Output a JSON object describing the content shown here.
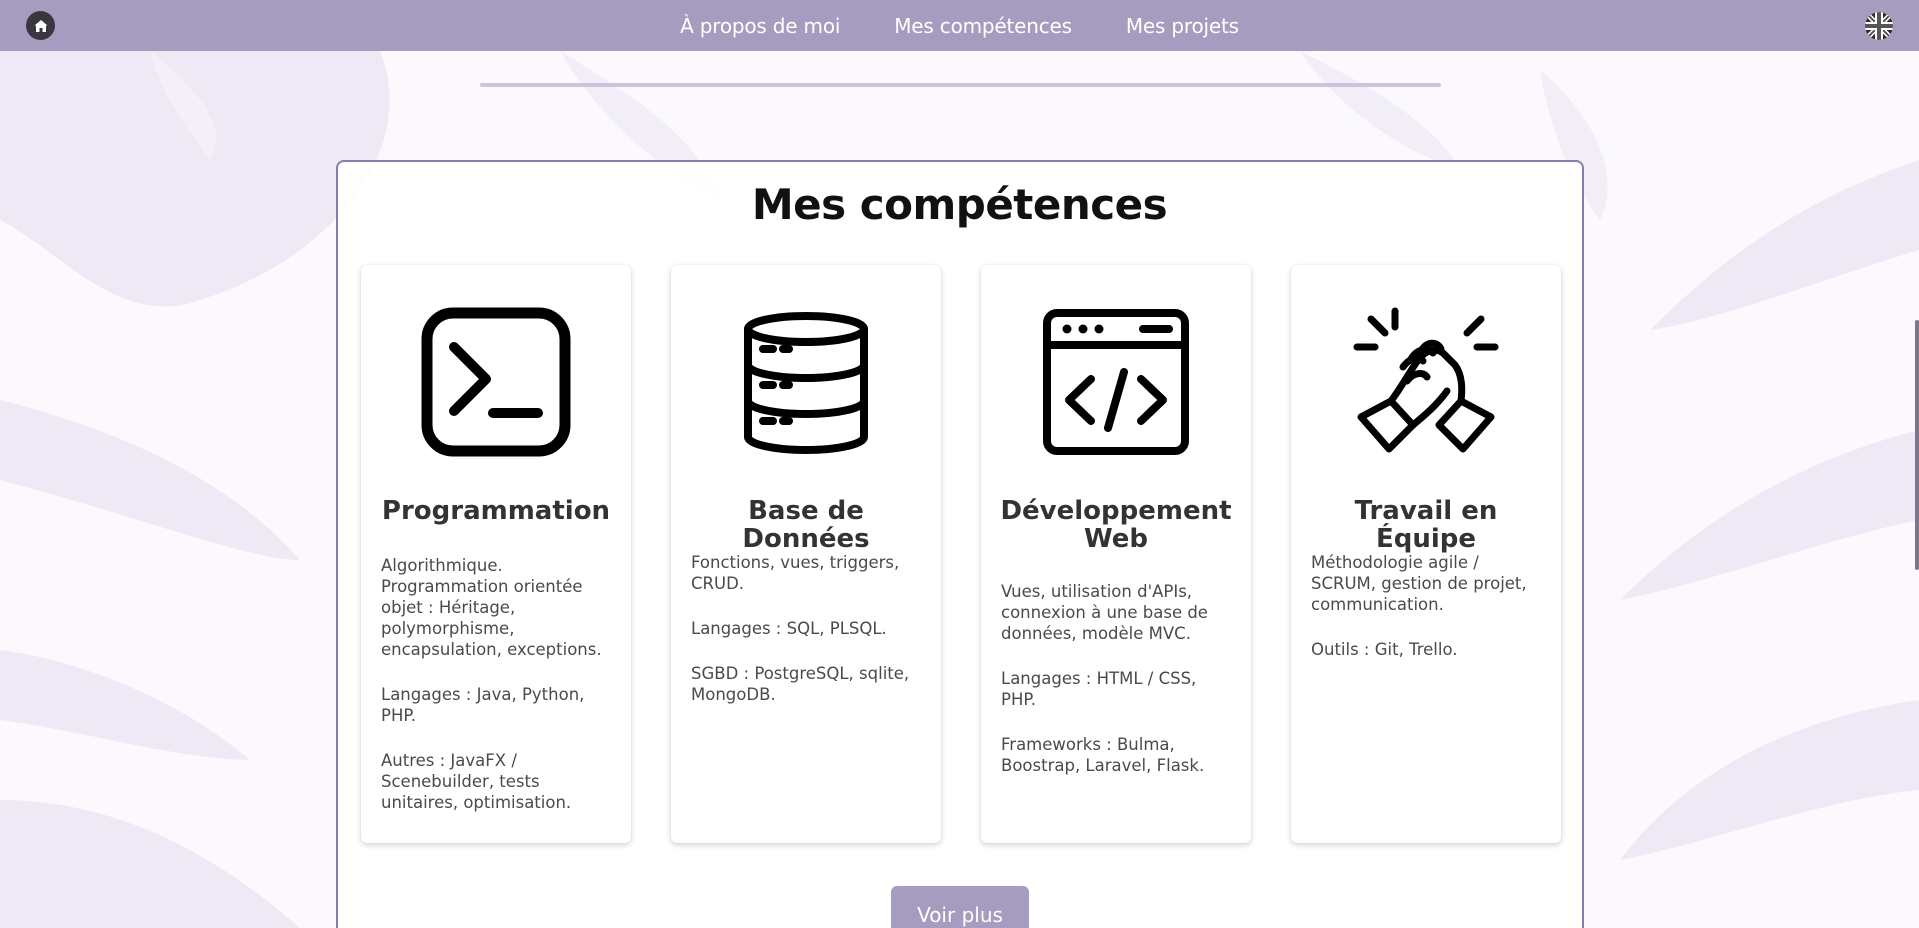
{
  "nav": {
    "links": [
      "À propos de moi",
      "Mes compétences",
      "Mes projets"
    ]
  },
  "skills": {
    "title": "Mes compétences",
    "cards": [
      {
        "icon": "terminal-icon",
        "title": "Programmation",
        "paragraphs": [
          "Algorithmique. Programmation orientée objet : Héritage, polymorphisme, encapsulation, exceptions.",
          "Langages : Java, Python, PHP.",
          "Autres : JavaFX / Scenebuilder, tests unitaires, optimisation."
        ]
      },
      {
        "icon": "database-icon",
        "title": "Base de Données",
        "paragraphs": [
          "Fonctions, vues, triggers, CRUD.",
          "Langages : SQL, PLSQL.",
          "SGBD : PostgreSQL, sqlite, MongoDB."
        ]
      },
      {
        "icon": "code-window-icon",
        "title": "Développement Web",
        "paragraphs": [
          "Vues, utilisation d'APIs, connexion à une base de données, modèle MVC.",
          "Langages : HTML / CSS, PHP.",
          "Frameworks : Bulma, Boostrap, Laravel, Flask."
        ]
      },
      {
        "icon": "handshake-icon",
        "title": "Travail en Équipe",
        "paragraphs": [
          "Méthodologie agile / SCRUM, gestion de projet, communication.",
          "Outils : Git, Trello."
        ]
      }
    ],
    "more_label": "Voir plus"
  },
  "colors": {
    "navbar": "#a69cc0",
    "accent_border": "#8a7aae",
    "button": "#a69cc0"
  }
}
